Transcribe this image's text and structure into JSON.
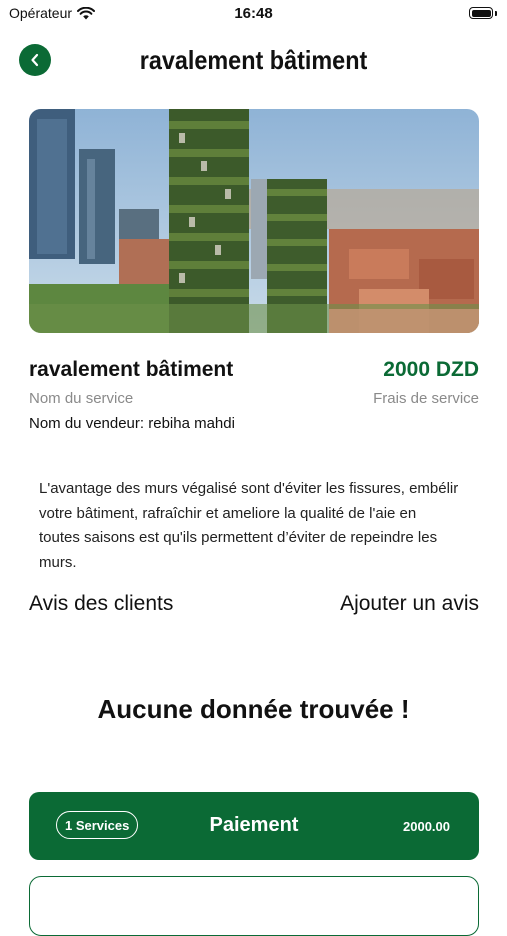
{
  "status_bar": {
    "carrier": "Opérateur",
    "time": "16:48"
  },
  "header": {
    "title": "ravalement bâtiment",
    "back_icon": "chevron-left-icon"
  },
  "service": {
    "name": "ravalement bâtiment",
    "price": "2000 DZD",
    "name_label": "Nom du service",
    "fee_label": "Frais de service",
    "vendor": "Nom du vendeur: rebiha mahdi",
    "description": "L'avantage des murs végalisé sont d'éviter les fissures, embélir votre bâtiment, rafraîchir et ameliore la qualité de l'aie en toutes saisons est qu'ils permettent d’éviter de repeindre les murs."
  },
  "reviews": {
    "title": "Avis des clients",
    "add_label": "Ajouter un avis",
    "empty_message": "Aucune donnée trouvée !"
  },
  "payment": {
    "services_count": "1 Services",
    "label": "Paiement",
    "amount": "2000.00"
  },
  "colors": {
    "primary": "#0b6a35",
    "muted": "#8a8a8a"
  }
}
